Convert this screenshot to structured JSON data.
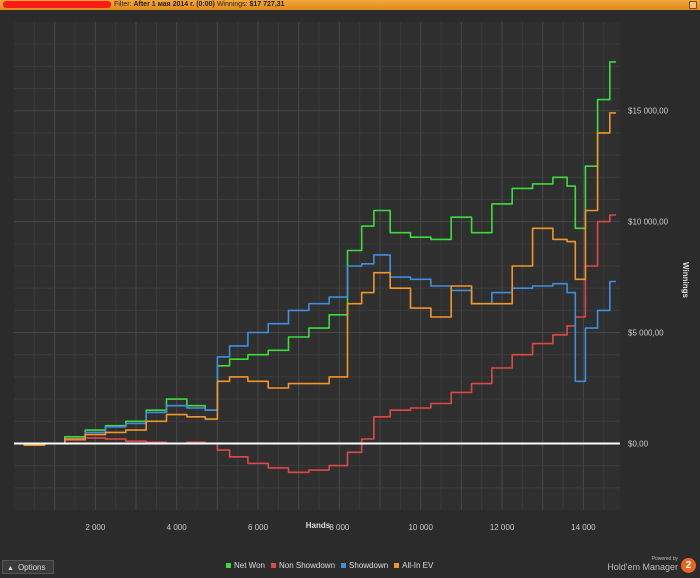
{
  "window": {
    "filter_label": "Filter:",
    "filter_value": "After 1 мая 2014 г. (0:00)",
    "winnings_label": "Winnings:",
    "winnings_value": "$17 727,31"
  },
  "footer": {
    "options_label": "Options",
    "brand_small": "Powered by",
    "brand_name": "Hold'em Manager",
    "brand_version": "2"
  },
  "colors": {
    "background": "#2b2b2b",
    "plot_bg": "#2f2f2f",
    "grid": "#424242",
    "title_bar": "#e8951f",
    "zero_line": "#ffffff"
  },
  "chart_data": {
    "type": "line",
    "xlabel": "Hands",
    "ylabel": "Winnings",
    "xlim": [
      0,
      14900
    ],
    "ylim": [
      -3000,
      19000
    ],
    "x_ticks": [
      2000,
      4000,
      6000,
      8000,
      10000,
      12000,
      14000
    ],
    "x_tick_labels": [
      "2 000",
      "4 000",
      "6 000",
      "8 000",
      "10 000",
      "12 000",
      "14 000"
    ],
    "y_ticks": [
      0,
      5000,
      10000,
      15000
    ],
    "y_tick_labels": [
      "$0,00",
      "$5 000,00",
      "$10 000,00",
      "$15 000,00"
    ],
    "grid": true,
    "legend_position": "bottom",
    "x": [
      0,
      500,
      1000,
      1500,
      2000,
      2500,
      3000,
      3500,
      4000,
      4500,
      4900,
      5100,
      5500,
      6000,
      6500,
      7000,
      7500,
      8000,
      8400,
      8700,
      9000,
      9500,
      10000,
      10500,
      11000,
      11500,
      12000,
      12500,
      13000,
      13500,
      13700,
      13900,
      14200,
      14500,
      14800
    ],
    "series": [
      {
        "name": "Net Won",
        "color": "#3ddc3d",
        "values": [
          0,
          -50,
          0,
          300,
          600,
          800,
          1000,
          1500,
          2000,
          1700,
          1500,
          3500,
          3800,
          4000,
          4200,
          4800,
          5200,
          5800,
          8700,
          9800,
          10500,
          9500,
          9300,
          9200,
          10200,
          9500,
          10800,
          11500,
          11700,
          12000,
          11600,
          9700,
          12500,
          15500,
          17200
        ]
      },
      {
        "name": "Non Showdown",
        "color": "#e04848",
        "values": [
          0,
          0,
          0,
          150,
          250,
          200,
          100,
          50,
          0,
          50,
          0,
          -300,
          -600,
          -900,
          -1100,
          -1300,
          -1200,
          -1000,
          -400,
          200,
          1200,
          1500,
          1600,
          1800,
          2300,
          2700,
          3400,
          4000,
          4500,
          4900,
          5300,
          5700,
          8000,
          10000,
          10300
        ]
      },
      {
        "name": "Showdown",
        "color": "#3f8ee0",
        "values": [
          0,
          -50,
          0,
          200,
          500,
          750,
          900,
          1400,
          1700,
          1600,
          1500,
          3900,
          4400,
          5000,
          5400,
          6000,
          6300,
          6600,
          8000,
          8100,
          8500,
          7500,
          7400,
          7100,
          6900,
          6300,
          6800,
          7000,
          7100,
          7200,
          6800,
          2800,
          5200,
          6000,
          7300
        ]
      },
      {
        "name": "All-In EV",
        "color": "#f0962a",
        "values": [
          0,
          -80,
          0,
          200,
          400,
          500,
          600,
          1000,
          1300,
          1200,
          1100,
          2800,
          3000,
          2800,
          2500,
          2700,
          2700,
          3000,
          6300,
          6800,
          7700,
          7000,
          6100,
          5700,
          7100,
          6300,
          6300,
          8000,
          9700,
          9200,
          9100,
          7400,
          10500,
          14000,
          14900
        ]
      }
    ]
  }
}
